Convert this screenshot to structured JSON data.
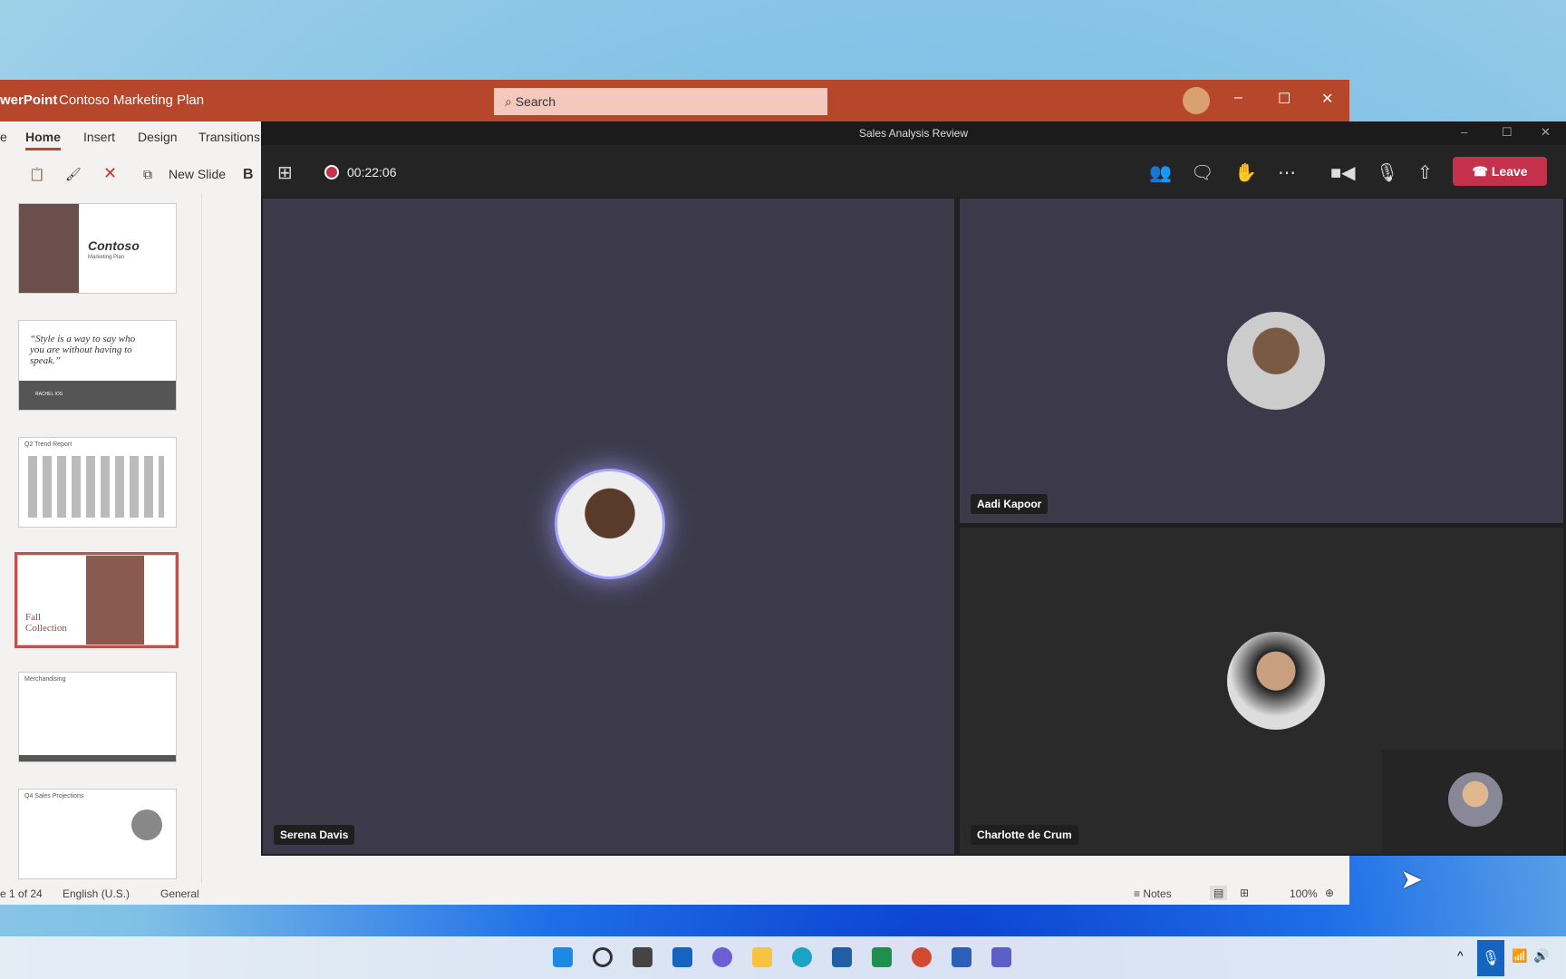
{
  "powerpoint": {
    "app": "werPoint",
    "doc": "Contoso Marketing Plan",
    "search": "Search",
    "tabs": [
      "e",
      "Home",
      "Insert",
      "Design",
      "Transitions"
    ],
    "new_slide": "New Slide",
    "bold": "B",
    "slides": [
      {
        "title": "Contoso",
        "sub": "Marketing Plan"
      },
      {
        "quote": "“Style is a way to say who you are without having to speak.”",
        "author": "RACHEL IOS"
      },
      {
        "title": "Q2 Trend Report"
      },
      {
        "title": "Fall Collection"
      },
      {
        "title": "Merchandising"
      },
      {
        "title": "Q4 Sales Projections"
      }
    ],
    "status": {
      "slide": "e 1 of 24",
      "lang": "English (U.S.)",
      "label": "General",
      "notes": "Notes",
      "zoom": "100%"
    }
  },
  "teams": {
    "title": "Sales Analysis Review",
    "timer": "00:22:06",
    "leave": "Leave",
    "participants": [
      "Serena Davis",
      "Aadi Kapoor",
      "Charlotte de Crum"
    ],
    "colors": {
      "leave": "#c4314b",
      "ppt": "#b7472a"
    }
  }
}
